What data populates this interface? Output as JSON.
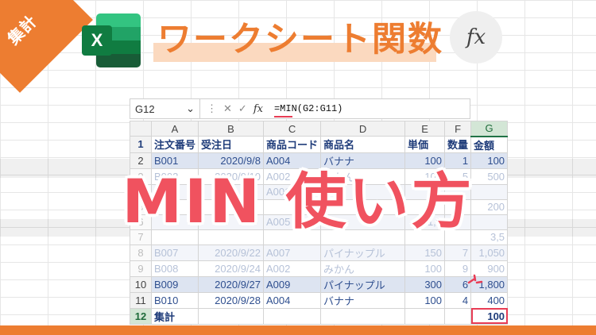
{
  "corner_label": "集計",
  "logo": {
    "letter": "X"
  },
  "title": "ワークシート関数",
  "fx_badge": "fx",
  "formula_bar": {
    "name_box": "G12",
    "chevron": "⌄",
    "more": "⋮",
    "cancel": "✕",
    "enter": "✓",
    "fx": "fx",
    "formula": "=MIN(G2:G11)"
  },
  "sheet": {
    "columns": [
      "A",
      "B",
      "C",
      "D",
      "E",
      "F",
      "G"
    ],
    "rows": [
      {
        "n": "1",
        "cells": [
          "注文番号",
          "受注日",
          "商品コード",
          "商品名",
          "単価",
          "数量",
          "金額"
        ]
      },
      {
        "n": "2",
        "cells": [
          "B001",
          "2020/9/8",
          "A004",
          "バナナ",
          "100",
          "1",
          "100"
        ]
      },
      {
        "n": "3",
        "cells": [
          "B002",
          "2020/9/10",
          "A002",
          "みかん",
          "100",
          "5",
          "500"
        ]
      },
      {
        "n": "4",
        "cells": [
          "B003",
          "",
          "A001",
          "",
          "",
          "",
          ""
        ]
      },
      {
        "n": "5",
        "cells": [
          "",
          "",
          "",
          "",
          "",
          "",
          "200"
        ]
      },
      {
        "n": "6",
        "cells": [
          "",
          "",
          "A005",
          "",
          "1,0",
          "",
          ""
        ]
      },
      {
        "n": "7",
        "cells": [
          "",
          "",
          "",
          "",
          "",
          "",
          "3,5"
        ]
      },
      {
        "n": "8",
        "cells": [
          "B007",
          "2020/9/22",
          "A007",
          "パイナップル",
          "150",
          "7",
          "1,050"
        ]
      },
      {
        "n": "9",
        "cells": [
          "B008",
          "2020/9/24",
          "A002",
          "みかん",
          "100",
          "9",
          "900"
        ]
      },
      {
        "n": "10",
        "cells": [
          "B009",
          "2020/9/27",
          "A009",
          "パイナップル",
          "300",
          "6",
          "1,800"
        ]
      },
      {
        "n": "11",
        "cells": [
          "B010",
          "2020/9/28",
          "A004",
          "バナナ",
          "100",
          "4",
          "400"
        ]
      },
      {
        "n": "12",
        "cells": [
          "集計",
          "",
          "",
          "",
          "",
          "",
          "100"
        ]
      }
    ]
  },
  "headline": "MIN 使い方",
  "colors": {
    "accent": "#ed7d31",
    "headline": "#f0525f",
    "excel_green": "#107c41"
  }
}
